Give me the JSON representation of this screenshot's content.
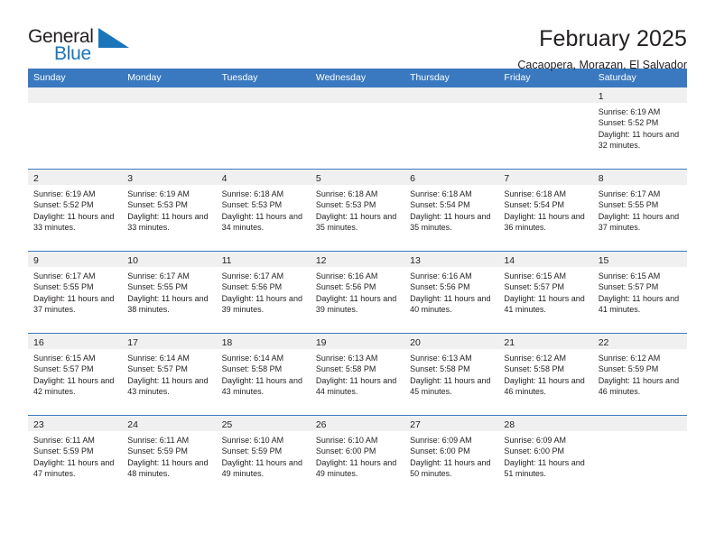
{
  "brand": {
    "name_part1": "General",
    "name_part2": "Blue",
    "triangle_color": "#1b75bb"
  },
  "header": {
    "title": "February 2025",
    "location": "Cacaopera, Morazan, El Salvador"
  },
  "theme": {
    "header_blue": "#3a79bf",
    "daynum_band": "#f0f0f0",
    "text": "#231f20"
  },
  "weekdays": [
    "Sunday",
    "Monday",
    "Tuesday",
    "Wednesday",
    "Thursday",
    "Friday",
    "Saturday"
  ],
  "weeks": [
    [
      {
        "day": "",
        "empty": true
      },
      {
        "day": "",
        "empty": true
      },
      {
        "day": "",
        "empty": true
      },
      {
        "day": "",
        "empty": true
      },
      {
        "day": "",
        "empty": true
      },
      {
        "day": "",
        "empty": true
      },
      {
        "day": "1",
        "sunrise": "Sunrise: 6:19 AM",
        "sunset": "Sunset: 5:52 PM",
        "daylight": "Daylight: 11 hours and 32 minutes."
      }
    ],
    [
      {
        "day": "2",
        "sunrise": "Sunrise: 6:19 AM",
        "sunset": "Sunset: 5:52 PM",
        "daylight": "Daylight: 11 hours and 33 minutes."
      },
      {
        "day": "3",
        "sunrise": "Sunrise: 6:19 AM",
        "sunset": "Sunset: 5:53 PM",
        "daylight": "Daylight: 11 hours and 33 minutes."
      },
      {
        "day": "4",
        "sunrise": "Sunrise: 6:18 AM",
        "sunset": "Sunset: 5:53 PM",
        "daylight": "Daylight: 11 hours and 34 minutes."
      },
      {
        "day": "5",
        "sunrise": "Sunrise: 6:18 AM",
        "sunset": "Sunset: 5:53 PM",
        "daylight": "Daylight: 11 hours and 35 minutes."
      },
      {
        "day": "6",
        "sunrise": "Sunrise: 6:18 AM",
        "sunset": "Sunset: 5:54 PM",
        "daylight": "Daylight: 11 hours and 35 minutes."
      },
      {
        "day": "7",
        "sunrise": "Sunrise: 6:18 AM",
        "sunset": "Sunset: 5:54 PM",
        "daylight": "Daylight: 11 hours and 36 minutes."
      },
      {
        "day": "8",
        "sunrise": "Sunrise: 6:17 AM",
        "sunset": "Sunset: 5:55 PM",
        "daylight": "Daylight: 11 hours and 37 minutes."
      }
    ],
    [
      {
        "day": "9",
        "sunrise": "Sunrise: 6:17 AM",
        "sunset": "Sunset: 5:55 PM",
        "daylight": "Daylight: 11 hours and 37 minutes."
      },
      {
        "day": "10",
        "sunrise": "Sunrise: 6:17 AM",
        "sunset": "Sunset: 5:55 PM",
        "daylight": "Daylight: 11 hours and 38 minutes."
      },
      {
        "day": "11",
        "sunrise": "Sunrise: 6:17 AM",
        "sunset": "Sunset: 5:56 PM",
        "daylight": "Daylight: 11 hours and 39 minutes."
      },
      {
        "day": "12",
        "sunrise": "Sunrise: 6:16 AM",
        "sunset": "Sunset: 5:56 PM",
        "daylight": "Daylight: 11 hours and 39 minutes."
      },
      {
        "day": "13",
        "sunrise": "Sunrise: 6:16 AM",
        "sunset": "Sunset: 5:56 PM",
        "daylight": "Daylight: 11 hours and 40 minutes."
      },
      {
        "day": "14",
        "sunrise": "Sunrise: 6:15 AM",
        "sunset": "Sunset: 5:57 PM",
        "daylight": "Daylight: 11 hours and 41 minutes."
      },
      {
        "day": "15",
        "sunrise": "Sunrise: 6:15 AM",
        "sunset": "Sunset: 5:57 PM",
        "daylight": "Daylight: 11 hours and 41 minutes."
      }
    ],
    [
      {
        "day": "16",
        "sunrise": "Sunrise: 6:15 AM",
        "sunset": "Sunset: 5:57 PM",
        "daylight": "Daylight: 11 hours and 42 minutes."
      },
      {
        "day": "17",
        "sunrise": "Sunrise: 6:14 AM",
        "sunset": "Sunset: 5:57 PM",
        "daylight": "Daylight: 11 hours and 43 minutes."
      },
      {
        "day": "18",
        "sunrise": "Sunrise: 6:14 AM",
        "sunset": "Sunset: 5:58 PM",
        "daylight": "Daylight: 11 hours and 43 minutes."
      },
      {
        "day": "19",
        "sunrise": "Sunrise: 6:13 AM",
        "sunset": "Sunset: 5:58 PM",
        "daylight": "Daylight: 11 hours and 44 minutes."
      },
      {
        "day": "20",
        "sunrise": "Sunrise: 6:13 AM",
        "sunset": "Sunset: 5:58 PM",
        "daylight": "Daylight: 11 hours and 45 minutes."
      },
      {
        "day": "21",
        "sunrise": "Sunrise: 6:12 AM",
        "sunset": "Sunset: 5:58 PM",
        "daylight": "Daylight: 11 hours and 46 minutes."
      },
      {
        "day": "22",
        "sunrise": "Sunrise: 6:12 AM",
        "sunset": "Sunset: 5:59 PM",
        "daylight": "Daylight: 11 hours and 46 minutes."
      }
    ],
    [
      {
        "day": "23",
        "sunrise": "Sunrise: 6:11 AM",
        "sunset": "Sunset: 5:59 PM",
        "daylight": "Daylight: 11 hours and 47 minutes."
      },
      {
        "day": "24",
        "sunrise": "Sunrise: 6:11 AM",
        "sunset": "Sunset: 5:59 PM",
        "daylight": "Daylight: 11 hours and 48 minutes."
      },
      {
        "day": "25",
        "sunrise": "Sunrise: 6:10 AM",
        "sunset": "Sunset: 5:59 PM",
        "daylight": "Daylight: 11 hours and 49 minutes."
      },
      {
        "day": "26",
        "sunrise": "Sunrise: 6:10 AM",
        "sunset": "Sunset: 6:00 PM",
        "daylight": "Daylight: 11 hours and 49 minutes."
      },
      {
        "day": "27",
        "sunrise": "Sunrise: 6:09 AM",
        "sunset": "Sunset: 6:00 PM",
        "daylight": "Daylight: 11 hours and 50 minutes."
      },
      {
        "day": "28",
        "sunrise": "Sunrise: 6:09 AM",
        "sunset": "Sunset: 6:00 PM",
        "daylight": "Daylight: 11 hours and 51 minutes."
      },
      {
        "day": "",
        "empty": true
      }
    ]
  ]
}
